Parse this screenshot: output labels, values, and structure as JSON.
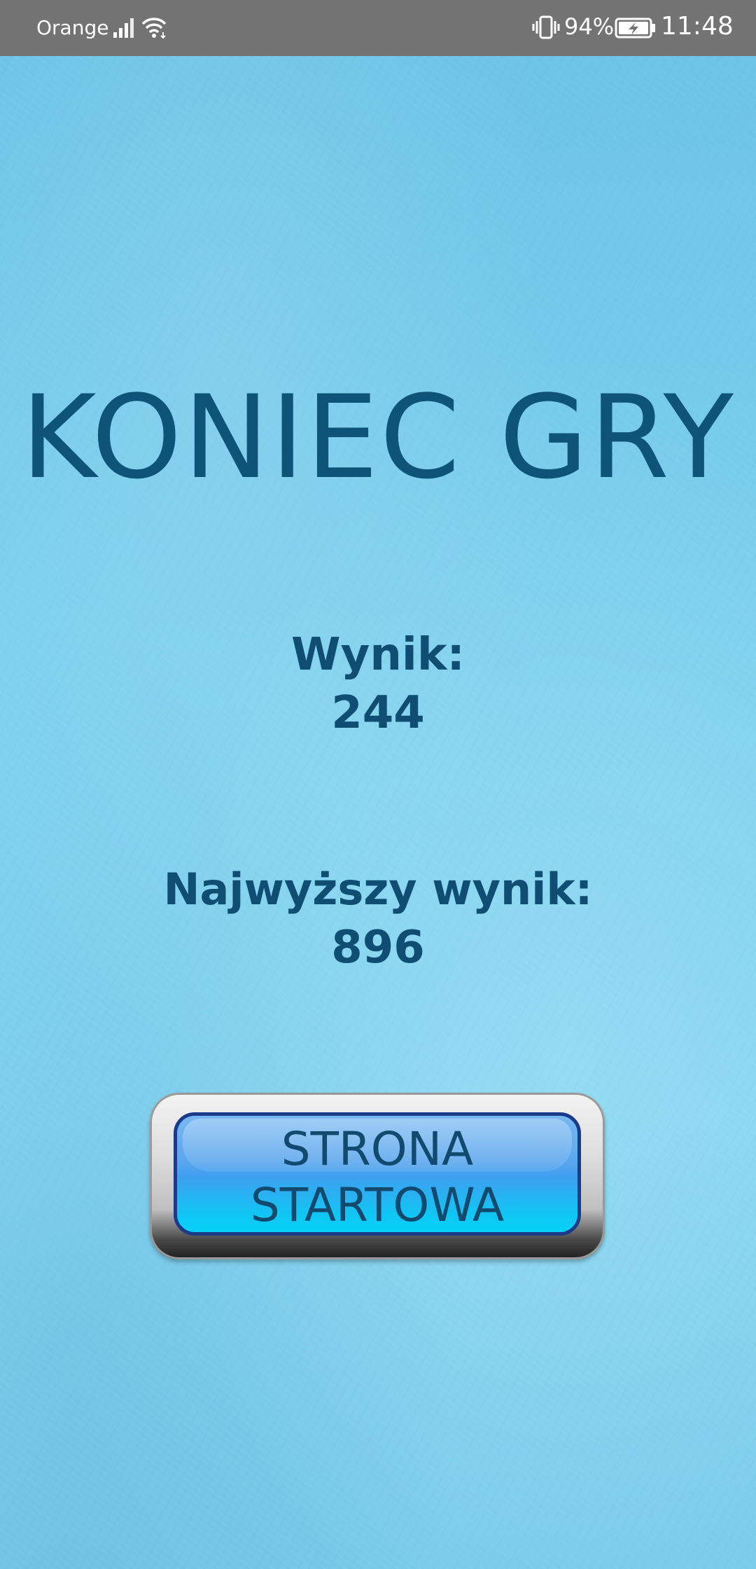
{
  "status_bar": {
    "carrier": "Orange",
    "battery_percent": "94%",
    "time": "11:48",
    "icons": [
      "signal-icon",
      "wifi-icon",
      "vibrate-icon",
      "battery-charging-icon"
    ]
  },
  "game_over": {
    "title": "KONIEC GRY",
    "score_label": "Wynik:",
    "score_value": "244",
    "high_score_label": "Najwyższy wynik:",
    "high_score_value": "896",
    "home_button_label": "STRONA\nSTARTOWA"
  },
  "colors": {
    "background": "#7fcfea",
    "title_text": "#0e5478",
    "button_fill": "#3f9ff0",
    "status_bar": "#737373"
  }
}
